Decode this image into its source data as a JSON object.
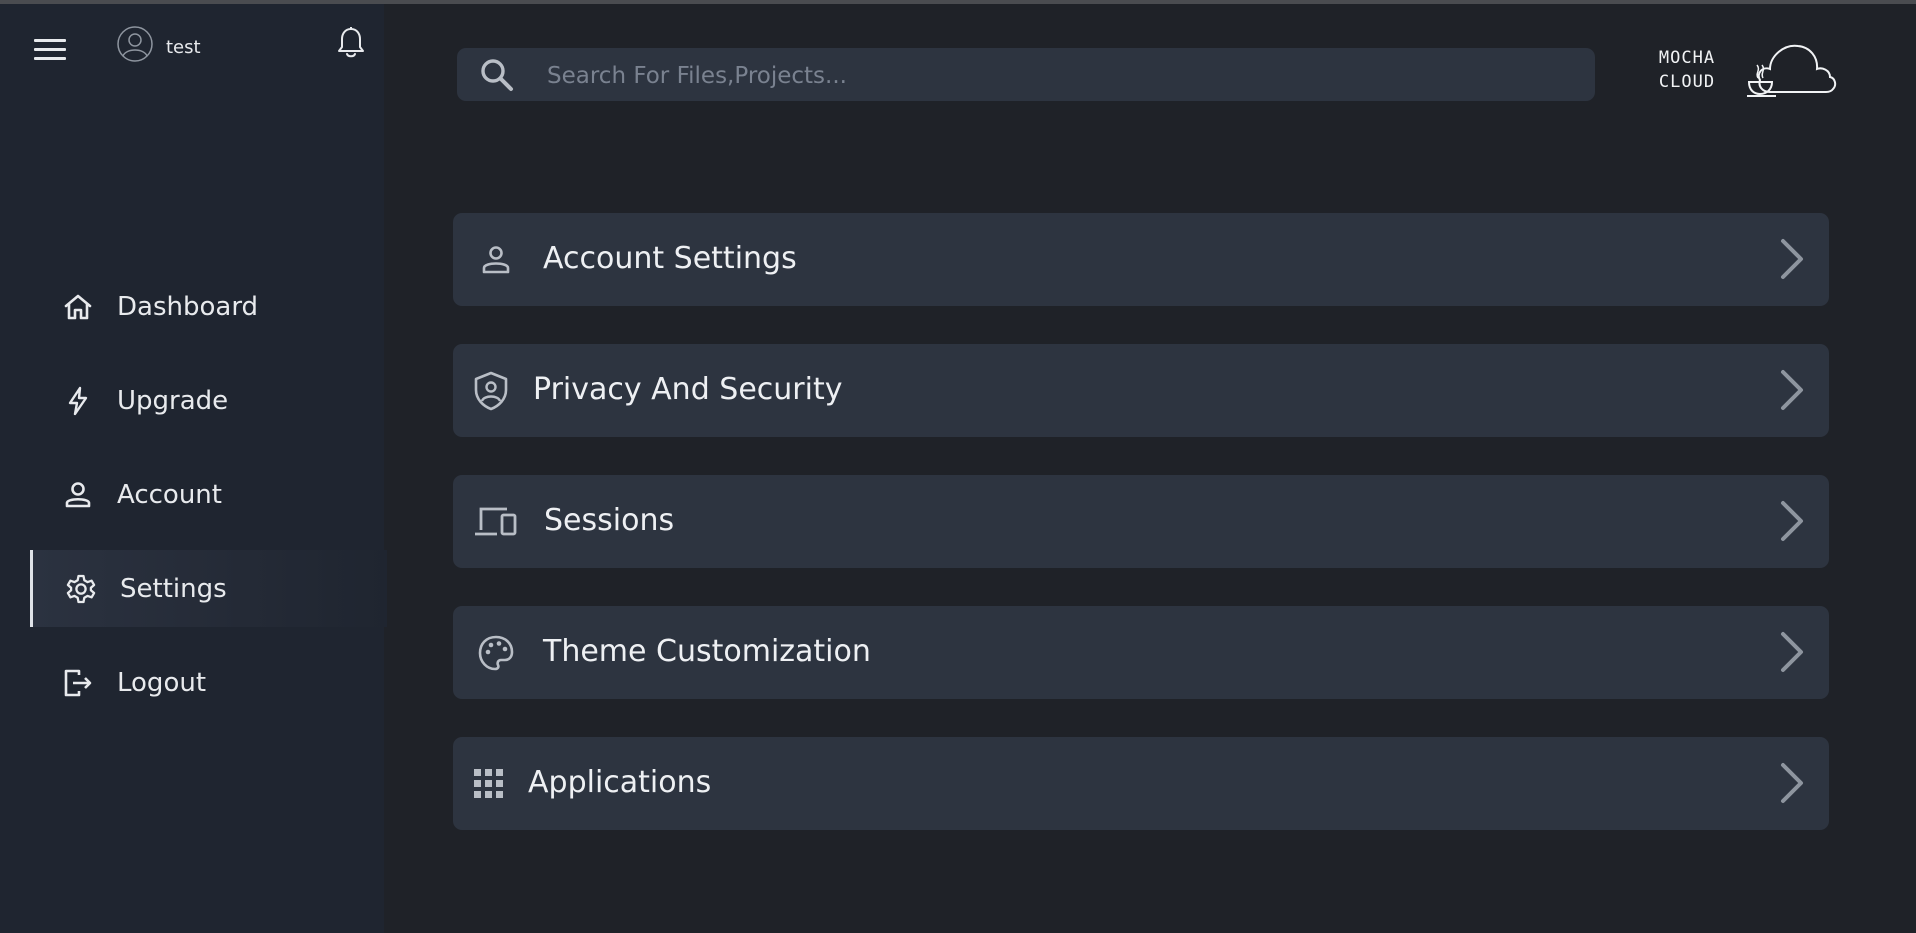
{
  "user": {
    "name": "test"
  },
  "sidebar": {
    "items": [
      {
        "label": "Dashboard",
        "icon": "home-icon",
        "active": false
      },
      {
        "label": "Upgrade",
        "icon": "bolt-icon",
        "active": false
      },
      {
        "label": "Account",
        "icon": "user-icon",
        "active": false
      },
      {
        "label": "Settings",
        "icon": "gear-icon",
        "active": true
      },
      {
        "label": "Logout",
        "icon": "logout-icon",
        "active": false
      }
    ]
  },
  "search": {
    "placeholder": "Search For Files,Projects...",
    "value": ""
  },
  "logo": {
    "line1": "MOCHA",
    "line2": "CLOUD"
  },
  "settings": {
    "items": [
      {
        "label": "Account Settings",
        "icon": "user-icon"
      },
      {
        "label": "Privacy And Security",
        "icon": "shield-icon"
      },
      {
        "label": "Sessions",
        "icon": "devices-icon"
      },
      {
        "label": "Theme Customization",
        "icon": "palette-icon"
      },
      {
        "label": "Applications",
        "icon": "grid-icon"
      }
    ]
  },
  "colors": {
    "background": "#1f2228",
    "sidebar": "#1f2530",
    "card": "#2d3440",
    "text": "#e8eaed",
    "muted": "#7a8290"
  }
}
